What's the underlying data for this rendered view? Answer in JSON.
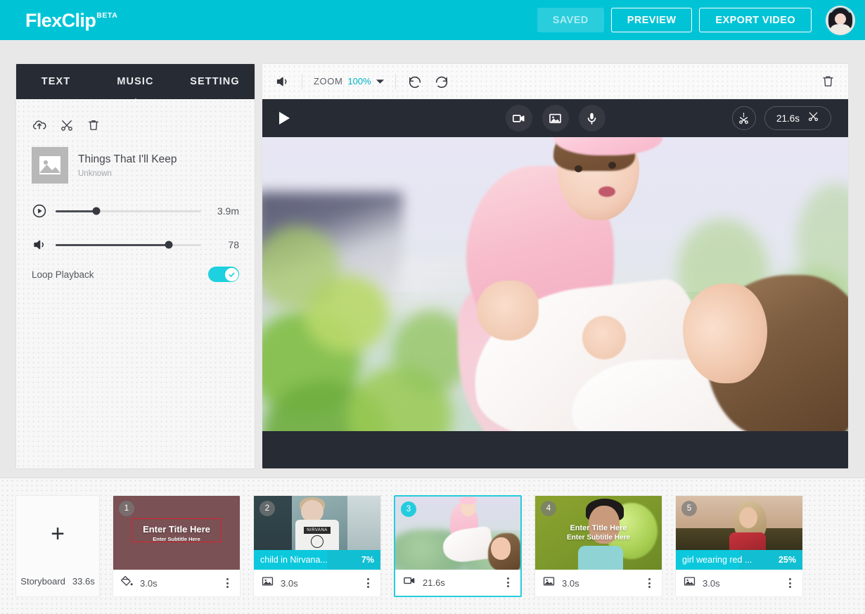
{
  "header": {
    "logo_text": "FlexClip",
    "logo_badge": "BETA",
    "saved_label": "SAVED",
    "preview_label": "PREVIEW",
    "export_label": "EXPORT VIDEO",
    "brand_color": "#00c4d6",
    "avatar_name": "user-avatar"
  },
  "left_panel": {
    "tabs": [
      {
        "label": "TEXT",
        "active": false
      },
      {
        "label": "MUSIC",
        "active": true
      },
      {
        "label": "SETTING",
        "active": false
      }
    ],
    "toolbar": {
      "upload_icon": "cloud-upload-icon",
      "cut_icon": "scissors-icon",
      "delete_icon": "trash-icon"
    },
    "track": {
      "title": "Things That I'll Keep",
      "artist": "Unknown",
      "thumb_icon": "image-placeholder-icon"
    },
    "duration_slider": {
      "icon": "play-circle-icon",
      "value": "3.9m",
      "percent": 28
    },
    "volume_slider": {
      "icon": "speaker-icon",
      "value": "78",
      "percent": 78
    },
    "loop": {
      "label": "Loop Playback",
      "enabled": true,
      "toggle_color": "#1fd0e0"
    }
  },
  "preview": {
    "toolbar": {
      "mute_icon": "speaker-icon",
      "zoom_label": "ZOOM",
      "zoom_value": "100%",
      "zoom_caret": "chevron-down-icon",
      "undo_icon": "undo-icon",
      "redo_icon": "redo-icon",
      "delete_icon": "trash-icon"
    },
    "controls": {
      "play_icon": "play-icon",
      "video_icon": "video-camera-icon",
      "image_icon": "image-icon",
      "mic_icon": "microphone-icon",
      "split_icon": "split-icon",
      "duration": "21.6s",
      "trim_icon": "scissors-icon"
    },
    "scene_alt": "Mother lifting baby girl in pink outdoors"
  },
  "storyboard": {
    "add_label_icon": "plus-icon",
    "label": "Storyboard",
    "total_duration": "33.6s",
    "clips": [
      {
        "number": "1",
        "kind": "color-clip",
        "type_icon": "paint-bucket-icon",
        "duration": "3.0s",
        "title_text": "Enter Title Here",
        "subtitle_text": "Enter Subtitle Here",
        "caption": null,
        "percent": null,
        "selected": false
      },
      {
        "number": "2",
        "kind": "image-clip",
        "type_icon": "image-icon",
        "duration": "3.0s",
        "title_text": null,
        "subtitle_text": null,
        "caption": "child in Nirvana...",
        "percent": "7%",
        "percent_value": 7,
        "selected": false
      },
      {
        "number": "3",
        "kind": "video-clip",
        "type_icon": "video-camera-icon",
        "duration": "21.6s",
        "title_text": null,
        "subtitle_text": null,
        "caption": null,
        "percent": null,
        "selected": true
      },
      {
        "number": "4",
        "kind": "image-clip",
        "type_icon": "image-icon",
        "duration": "3.0s",
        "title_text": "Enter Title Here",
        "subtitle_text": "Enter Subtitle Here",
        "caption": null,
        "percent": null,
        "selected": false
      },
      {
        "number": "5",
        "kind": "image-clip",
        "type_icon": "image-icon",
        "duration": "3.0s",
        "title_text": null,
        "subtitle_text": null,
        "caption": "girl wearing red ...",
        "percent": "25%",
        "percent_value": 25,
        "selected": false
      }
    ]
  },
  "nirvana_logo": "NIRVANA"
}
